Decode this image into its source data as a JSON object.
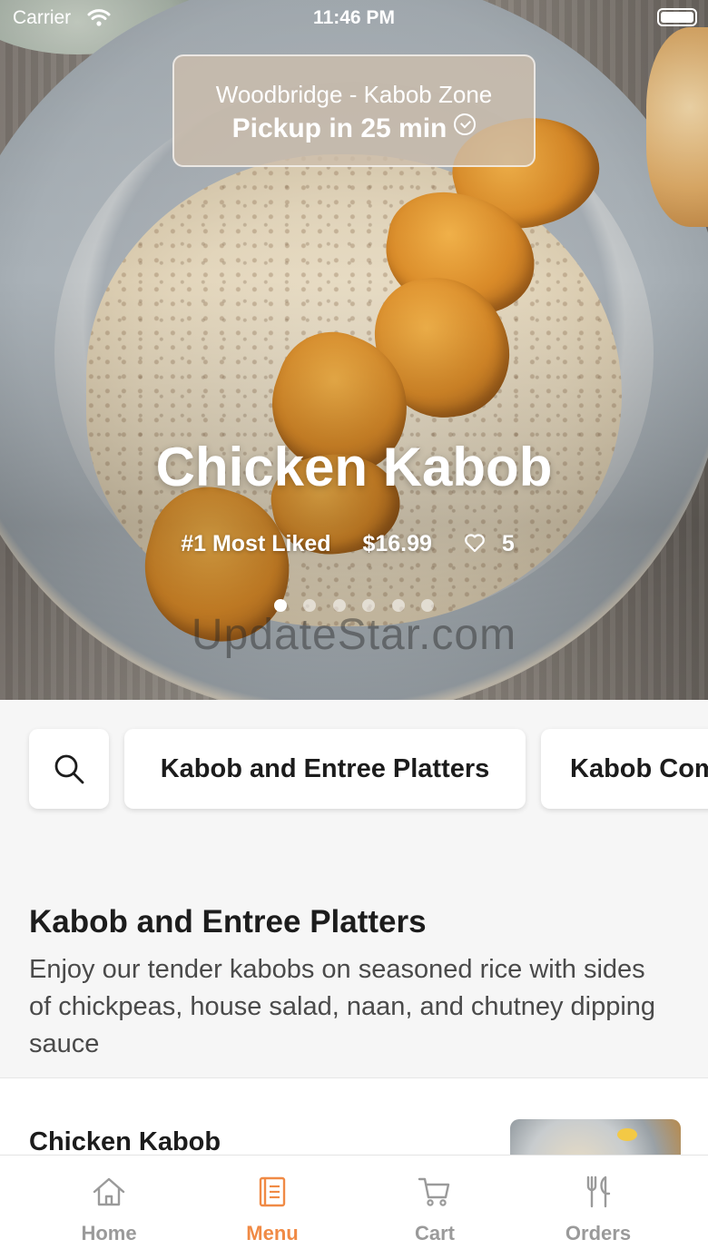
{
  "status_bar": {
    "carrier": "Carrier",
    "time": "11:46 PM"
  },
  "location": {
    "name": "Woodbridge - Kabob Zone",
    "pickup": "Pickup in 25 min"
  },
  "hero": {
    "title": "Chicken Kabob",
    "badge": "#1 Most Liked",
    "price": "$16.99",
    "likes": "5",
    "slide_count": 6,
    "active_slide": 1,
    "watermark": "UpdateStar.com"
  },
  "categories": {
    "items": [
      {
        "label": "Kabob and Entree Platters"
      },
      {
        "label": "Kabob Combos"
      }
    ]
  },
  "section": {
    "title": "Kabob and Entree Platters",
    "description": "Enjoy our tender kabobs on seasoned rice with sides of chickpeas, house salad, naan, and chutney dipping sauce"
  },
  "item": {
    "title": "Chicken Kabob"
  },
  "tabbar": {
    "items": [
      {
        "label": "Home",
        "icon": "home-icon"
      },
      {
        "label": "Menu",
        "icon": "menu-icon"
      },
      {
        "label": "Cart",
        "icon": "cart-icon"
      },
      {
        "label": "Orders",
        "icon": "orders-icon"
      }
    ],
    "active": "Menu",
    "accent_color": "#f08a45",
    "inactive_color": "#9a9a9a"
  }
}
